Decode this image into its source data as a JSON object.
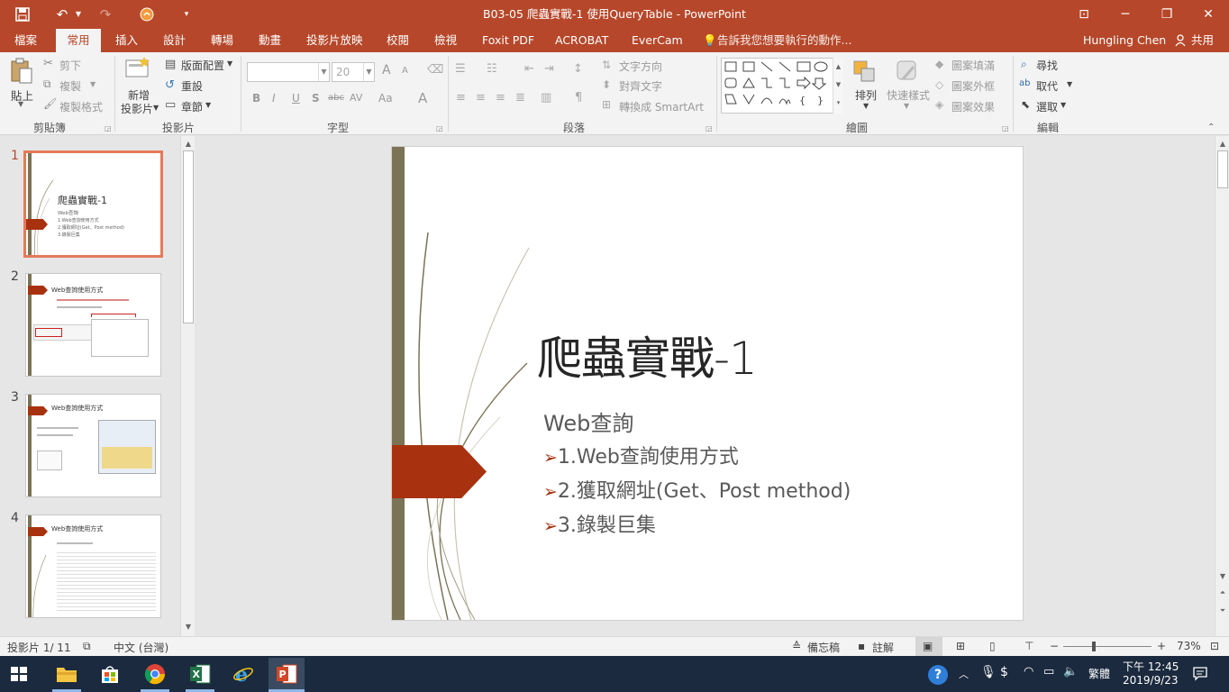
{
  "window": {
    "title": "B03-05 爬蟲實戰-1 使用QueryTable - PowerPoint",
    "undo_glyph": "↶",
    "redo_glyph": "↷",
    "minimize_glyph": "─",
    "restore_glyph": "❐",
    "close_glyph": "✕",
    "ribbon_display_glyph": "⊡"
  },
  "tabs": [
    "檔案",
    "常用",
    "插入",
    "設計",
    "轉場",
    "動畫",
    "投影片放映",
    "校閱",
    "檢視",
    "Foxit PDF",
    "ACROBAT",
    "EverCam"
  ],
  "active_tab": 1,
  "tell_me": "告訴我您想要執行的動作...",
  "user": "Hungling Chen",
  "share": "共用",
  "ribbon": {
    "clipboard": {
      "paste": "貼上",
      "cut": "剪下",
      "copy": "複製",
      "format_painter": "複製格式",
      "label": "剪貼簿"
    },
    "slides": {
      "new_slide_1": "新增",
      "new_slide_2": "投影片",
      "layout": "版面配置",
      "reset": "重設",
      "section": "章節",
      "label": "投影片"
    },
    "font": {
      "size": "20",
      "label": "字型",
      "bold": "B",
      "italic": "I",
      "underline": "U",
      "shadow": "S",
      "strike": "abc",
      "spacing": "AV",
      "case": "Aa",
      "color": "A",
      "grow": "A",
      "shrink": "A"
    },
    "paragraph": {
      "text_direction": "文字方向",
      "align_text": "對齊文字",
      "smartart": "轉換成 SmartArt",
      "label": "段落"
    },
    "drawing": {
      "arrange": "排列",
      "quick_styles": "快速樣式",
      "fill": "圖案填滿",
      "outline": "圖案外框",
      "effects": "圖案效果",
      "label": "繪圖"
    },
    "editing": {
      "find": "尋找",
      "replace": "取代",
      "select": "選取",
      "label": "編輯"
    }
  },
  "thumbnails": [
    {
      "num": "1",
      "title": "爬蟲實戰-1",
      "lines": [
        "Web查詢",
        "1.Web查詢使用方式",
        "2.獲取網址(Get、Post method)",
        "3.錄製巨集"
      ]
    },
    {
      "num": "2",
      "title": "Web查詢使用方式"
    },
    {
      "num": "3",
      "title": "Web查詢使用方式"
    },
    {
      "num": "4",
      "title": "Web查詢使用方式"
    }
  ],
  "slide": {
    "title": "爬蟲實戰-1",
    "subtitle": "Web查詢",
    "bullet_glyph": "➢",
    "bullets": [
      "1.Web查詢使用方式",
      "2.獲取網址(Get、Post method)",
      "3.錄製巨集"
    ],
    "colors": {
      "accent": "#a8320f",
      "bar": "#7b7355",
      "title": "#262626",
      "body": "#595959"
    }
  },
  "status": {
    "slide_pos": "投影片 1/ 11",
    "language": "中文 (台灣)",
    "notes": "備忘稿",
    "comments": "註解",
    "zoom": "73%",
    "zoom_value": 73,
    "minus": "−",
    "plus": "+"
  },
  "taskbar": {
    "time": "下午 12:45",
    "date": "2019/9/23",
    "ime": "繁體",
    "apps": [
      "start",
      "file-explorer",
      "store",
      "chrome",
      "excel",
      "internet-explorer",
      "powerpoint"
    ]
  },
  "theme": {
    "brand": "#b7472a",
    "ribbon_bg": "#f3f3f3",
    "taskbar_bg": "#1b2a3e"
  }
}
